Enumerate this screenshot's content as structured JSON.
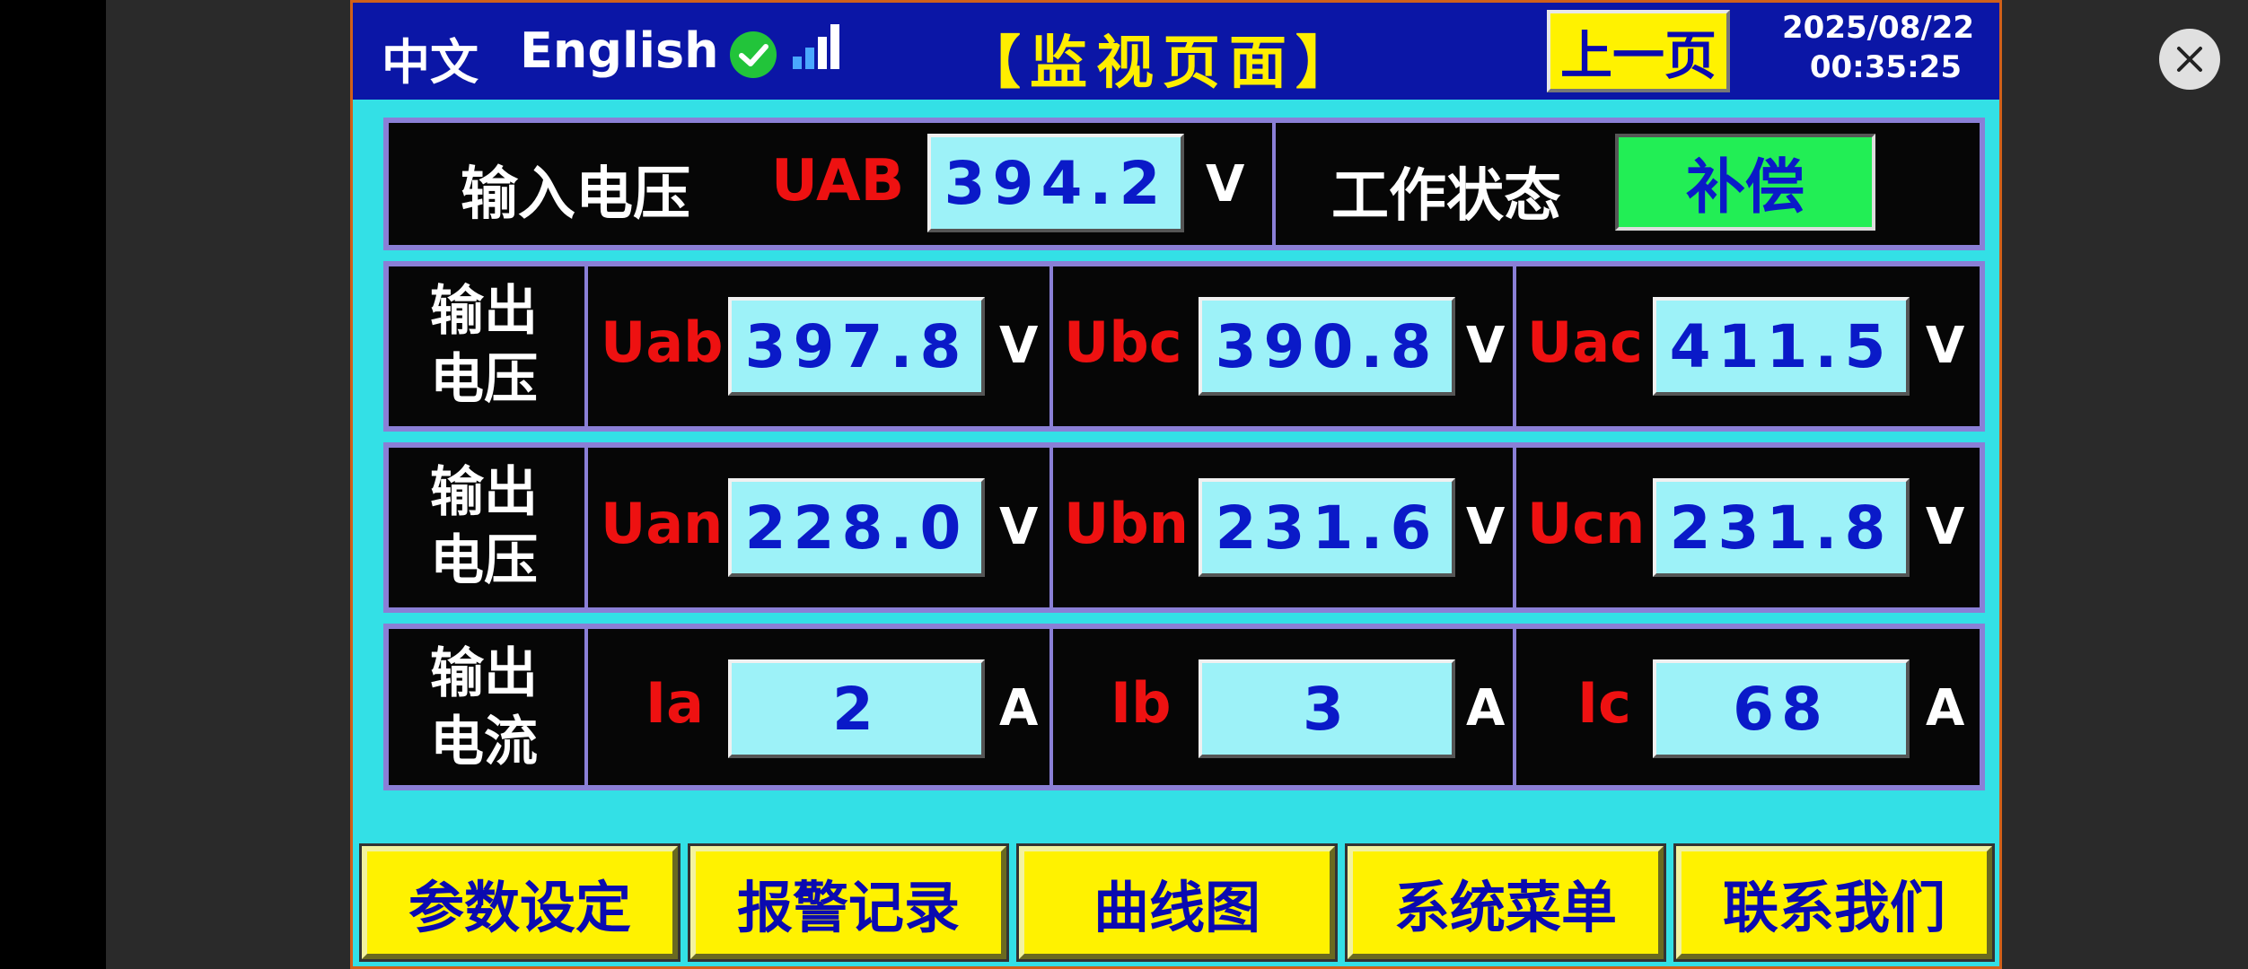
{
  "topbar": {
    "lang_zh": "中文",
    "lang_en": "English",
    "title": "【监视页面】",
    "prev_page": "上一页",
    "date": "2025/08/22",
    "time": "00:35:25"
  },
  "input": {
    "label": "输入电压",
    "name": "UAB",
    "value": "394.2",
    "unit": "V",
    "status_label": "工作状态",
    "status_value": "补偿"
  },
  "rows": [
    {
      "label_line1": "输出",
      "label_line2": "电压",
      "cells": [
        {
          "name": "Uab",
          "value": "397.8",
          "unit": "V"
        },
        {
          "name": "Ubc",
          "value": "390.8",
          "unit": "V"
        },
        {
          "name": "Uac",
          "value": "411.5",
          "unit": "V"
        }
      ]
    },
    {
      "label_line1": "输出",
      "label_line2": "电压",
      "cells": [
        {
          "name": "Uan",
          "value": "228.0",
          "unit": "V"
        },
        {
          "name": "Ubn",
          "value": "231.6",
          "unit": "V"
        },
        {
          "name": "Ucn",
          "value": "231.8",
          "unit": "V"
        }
      ]
    },
    {
      "label_line1": "输出",
      "label_line2": "电流",
      "cells": [
        {
          "name": "Ia",
          "value": "2",
          "unit": "A"
        },
        {
          "name": "Ib",
          "value": "3",
          "unit": "A"
        },
        {
          "name": "Ic",
          "value": "68",
          "unit": "A"
        }
      ]
    }
  ],
  "nav": [
    "参数设定",
    "报警记录",
    "曲线图",
    "系统菜单",
    "联系我们"
  ],
  "colors": {
    "header_bg": "#0b16a6",
    "panel_bg": "#33e0e6",
    "value_bg": "#9df2f8",
    "value_text": "#0a1ac8",
    "label_red": "#ee1111",
    "button_yellow": "#fff200",
    "status_green": "#22ee55"
  },
  "icons": {
    "check": "check-circle-icon",
    "signal": "signal-bars-icon",
    "close": "close-icon"
  }
}
